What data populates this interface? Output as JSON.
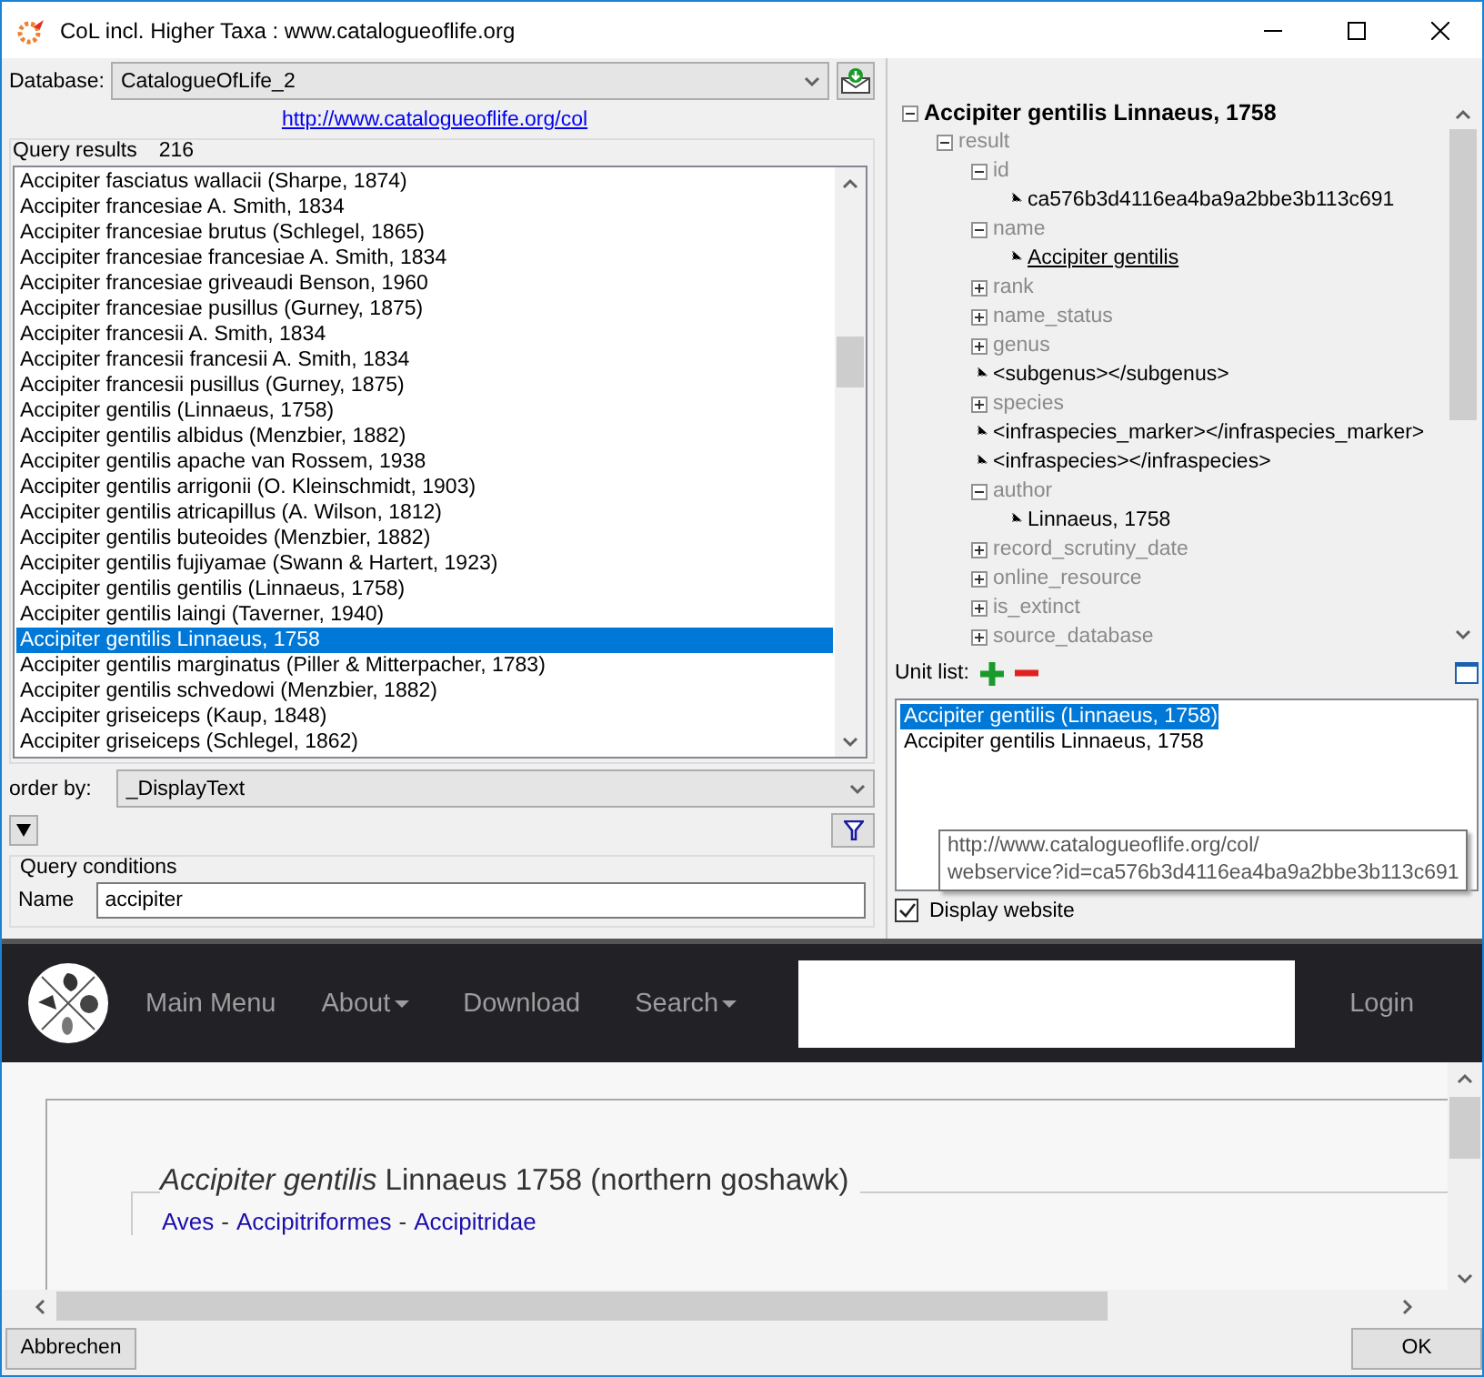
{
  "window": {
    "title": "CoL incl. Higher Taxa : www.catalogueoflife.org"
  },
  "database": {
    "label": "Database:",
    "value": "CatalogueOfLife_2"
  },
  "link": "http://www.catalogueoflife.org/col",
  "query_results": {
    "label": "Query results",
    "count": "216",
    "items": [
      {
        "text": "Accipiter fasciatus wallacii (Sharpe, 1874)",
        "selected": false
      },
      {
        "text": "Accipiter francesiae A. Smith, 1834",
        "selected": false
      },
      {
        "text": "Accipiter francesiae brutus (Schlegel, 1865)",
        "selected": false
      },
      {
        "text": "Accipiter francesiae francesiae A. Smith, 1834",
        "selected": false
      },
      {
        "text": "Accipiter francesiae griveaudi Benson, 1960",
        "selected": false
      },
      {
        "text": "Accipiter francesiae pusillus (Gurney, 1875)",
        "selected": false
      },
      {
        "text": "Accipiter francesii A. Smith, 1834",
        "selected": false
      },
      {
        "text": "Accipiter francesii francesii A. Smith, 1834",
        "selected": false
      },
      {
        "text": "Accipiter francesii pusillus (Gurney, 1875)",
        "selected": false
      },
      {
        "text": "Accipiter gentilis (Linnaeus, 1758)",
        "selected": false
      },
      {
        "text": "Accipiter gentilis albidus (Menzbier, 1882)",
        "selected": false
      },
      {
        "text": "Accipiter gentilis apache van Rossem, 1938",
        "selected": false
      },
      {
        "text": "Accipiter gentilis arrigonii (O. Kleinschmidt, 1903)",
        "selected": false
      },
      {
        "text": "Accipiter gentilis atricapillus (A. Wilson, 1812)",
        "selected": false
      },
      {
        "text": "Accipiter gentilis buteoides (Menzbier, 1882)",
        "selected": false
      },
      {
        "text": "Accipiter gentilis fujiyamae (Swann & Hartert, 1923)",
        "selected": false
      },
      {
        "text": "Accipiter gentilis gentilis (Linnaeus, 1758)",
        "selected": false
      },
      {
        "text": "Accipiter gentilis laingi (Taverner, 1940)",
        "selected": false
      },
      {
        "text": "Accipiter gentilis Linnaeus, 1758",
        "selected": true
      },
      {
        "text": "Accipiter gentilis marginatus (Piller & Mitterpacher, 1783)",
        "selected": false
      },
      {
        "text": "Accipiter gentilis schvedowi (Menzbier, 1882)",
        "selected": false
      },
      {
        "text": "Accipiter griseiceps (Kaup, 1848)",
        "selected": false
      },
      {
        "text": "Accipiter griseiceps (Schlegel, 1862)",
        "selected": false
      }
    ]
  },
  "order_by": {
    "label": "order by:",
    "value": "_DisplayText"
  },
  "query_conditions": {
    "title": "Query conditions",
    "fields": [
      {
        "label": "Name",
        "value": "accipiter"
      }
    ]
  },
  "tree": {
    "text": "Accipiter gentilis Linnaeus, 1758",
    "kind": "root",
    "expanded": true,
    "children": [
      {
        "text": "result",
        "kind": "key",
        "expanded": true,
        "children": [
          {
            "text": "id",
            "kind": "key",
            "expanded": true,
            "children": [
              {
                "text": "ca576b3d4116ea4ba9a2bbe3b113c691",
                "kind": "value"
              }
            ]
          },
          {
            "text": "name",
            "kind": "key",
            "expanded": true,
            "children": [
              {
                "text": "Accipiter gentilis",
                "kind": "link"
              }
            ]
          },
          {
            "text": "rank",
            "kind": "key",
            "expanded": false
          },
          {
            "text": "name_status",
            "kind": "key",
            "expanded": false
          },
          {
            "text": "genus",
            "kind": "key",
            "expanded": false
          },
          {
            "text": "<subgenus></subgenus>",
            "kind": "value"
          },
          {
            "text": "species",
            "kind": "key",
            "expanded": false
          },
          {
            "text": "<infraspecies_marker></infraspecies_marker>",
            "kind": "value"
          },
          {
            "text": "<infraspecies></infraspecies>",
            "kind": "value"
          },
          {
            "text": "author",
            "kind": "key",
            "expanded": true,
            "children": [
              {
                "text": "Linnaeus, 1758",
                "kind": "value"
              }
            ]
          },
          {
            "text": "record_scrutiny_date",
            "kind": "key",
            "expanded": false
          },
          {
            "text": "online_resource",
            "kind": "key",
            "expanded": false
          },
          {
            "text": "is_extinct",
            "kind": "key",
            "expanded": false
          },
          {
            "text": "source_database",
            "kind": "key",
            "expanded": false
          }
        ]
      }
    ]
  },
  "unit_list": {
    "label": "Unit list:",
    "items": [
      {
        "text": "Accipiter gentilis (Linnaeus, 1758)",
        "selected": true
      },
      {
        "text": "Accipiter gentilis Linnaeus, 1758",
        "selected": false
      }
    ],
    "tooltip": [
      "http://www.catalogueoflife.org/col/",
      "webservice?id=ca576b3d4116ea4ba9a2bbe3b113c691"
    ]
  },
  "display_website": {
    "label": "Display website",
    "checked": true
  },
  "browser": {
    "nav": [
      {
        "label": "Main Menu",
        "dropdown": false
      },
      {
        "label": "About",
        "dropdown": true
      },
      {
        "label": "Download",
        "dropdown": false
      },
      {
        "label": "Search",
        "dropdown": true
      }
    ],
    "login": "Login",
    "heading": "*Accipiter gentilis* Linnaeus 1758 (northern goshawk)",
    "breadcrumb": [
      "Aves",
      "Accipitriformes",
      "Accipitridae"
    ],
    "separator": "-"
  },
  "buttons": {
    "cancel": "Abbrechen",
    "ok": "OK"
  }
}
